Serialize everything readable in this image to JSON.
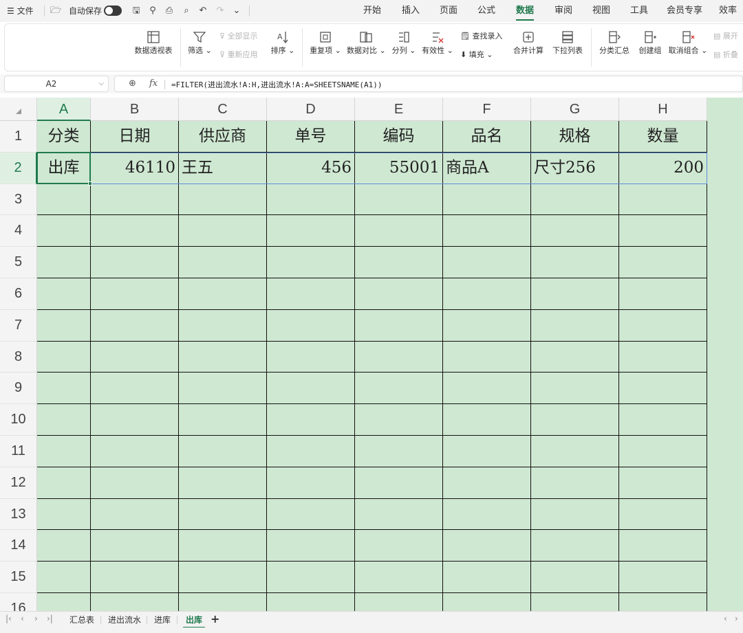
{
  "menubar": {
    "menu_label": "文件",
    "autosave_label": "自动保存",
    "tabs": [
      "开始",
      "插入",
      "页面",
      "公式",
      "数据",
      "审阅",
      "视图",
      "工具",
      "会员专享",
      "效率"
    ],
    "active_tab": "数据"
  },
  "ribbon": {
    "pivot": "数据透视表",
    "filter": "筛选",
    "show_all": "全部显示",
    "reapply": "重新应用",
    "sort": "排序",
    "duplicates": "重复项",
    "compare": "数据对比",
    "split": "分列",
    "validity": "有效性",
    "lookup_entry": "查找录入",
    "fill": "填充",
    "consolidate": "合并计算",
    "dropdown_list": "下拉列表",
    "subtotal": "分类汇总",
    "group": "创建组",
    "ungroup": "取消组合",
    "expand": "展开",
    "collapse": "折叠"
  },
  "formula_bar": {
    "name_box": "A2",
    "fx": "fx",
    "formula": "=FILTER(进出流水!A:H,进出流水!A:A=SHEETSNAME(A1))"
  },
  "grid": {
    "columns": [
      "A",
      "B",
      "C",
      "D",
      "E",
      "F",
      "G",
      "H"
    ],
    "rows": [
      "1",
      "2",
      "3",
      "4",
      "5",
      "6",
      "7",
      "8",
      "9",
      "10",
      "11",
      "12",
      "13",
      "14",
      "15",
      "16"
    ],
    "headers": [
      "分类",
      "日期",
      "供应商",
      "单号",
      "编码",
      "品名",
      "规格",
      "数量"
    ],
    "row2": [
      "出库",
      "46110",
      "王五",
      "456",
      "55001",
      "商品A",
      "尺寸256",
      "200"
    ],
    "selected_cell": "A2",
    "fill_color": "#cfe8d2",
    "accent_color": "#1f7a4d"
  },
  "sheets": {
    "tabs": [
      "汇总表",
      "进出流水",
      "进库",
      "出库"
    ],
    "active": "出库",
    "add_label": "+"
  }
}
